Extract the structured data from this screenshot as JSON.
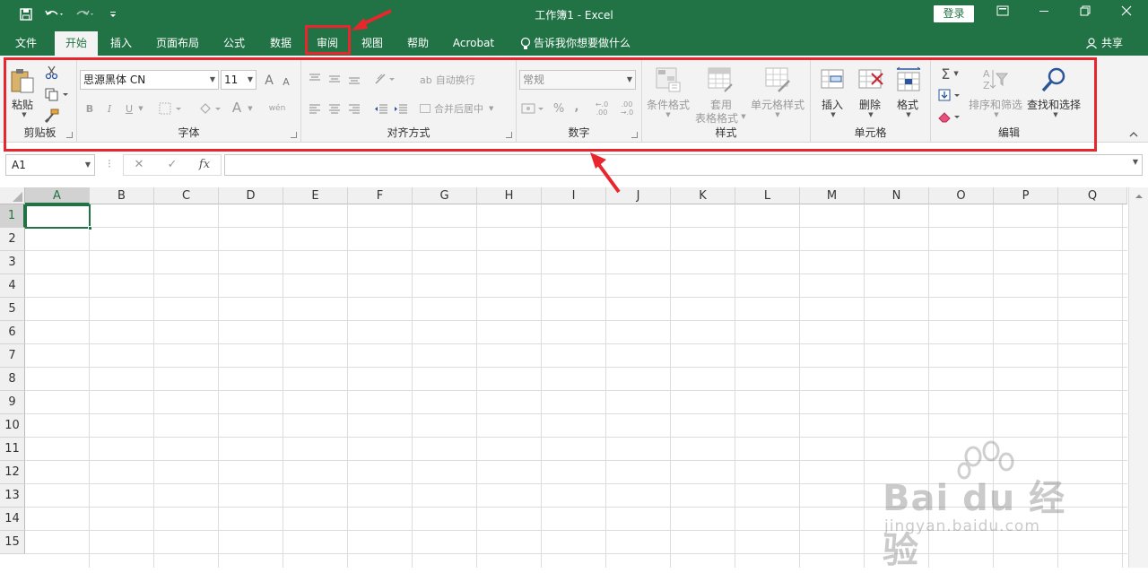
{
  "app": {
    "title": "工作簿1  -  Excel",
    "login_label": "登录",
    "share_label": "共享",
    "tell_me": "告诉我你想要做什么"
  },
  "tabs": [
    {
      "label": "文件"
    },
    {
      "label": "开始"
    },
    {
      "label": "插入"
    },
    {
      "label": "页面布局"
    },
    {
      "label": "公式"
    },
    {
      "label": "数据"
    },
    {
      "label": "审阅"
    },
    {
      "label": "视图"
    },
    {
      "label": "帮助"
    },
    {
      "label": "Acrobat"
    }
  ],
  "ribbon": {
    "clipboard": {
      "label": "剪贴板",
      "paste_label": "粘贴"
    },
    "font": {
      "label": "字体",
      "font_name": "思源黑体 CN",
      "font_size": "11",
      "bold": "B",
      "italic": "I",
      "underline": "U",
      "grow_font": "A",
      "shrink_font": "A",
      "font_color": "A",
      "phonetic": "wén"
    },
    "alignment": {
      "label": "对齐方式",
      "wrap_text": "自动换行",
      "merge_center": "合并后居中"
    },
    "number": {
      "label": "数字",
      "format": "常规",
      "percent": "%",
      "comma": ",",
      "increase_decimal": "←.0 .00",
      "decrease_decimal": ".00 →.0"
    },
    "styles": {
      "label": "样式",
      "conditional": "条件格式",
      "table_format_1": "套用",
      "table_format_2": "表格格式",
      "cell_styles": "单元格样式"
    },
    "cells": {
      "label": "单元格",
      "insert": "插入",
      "delete": "删除",
      "format": "格式"
    },
    "editing": {
      "label": "编辑",
      "sort_filter": "排序和筛选",
      "find_select": "查找和选择"
    }
  },
  "formula_bar": {
    "name_box": "A1",
    "fx": "fx",
    "value": ""
  },
  "sheet": {
    "columns": [
      "A",
      "B",
      "C",
      "D",
      "E",
      "F",
      "G",
      "H",
      "I",
      "J",
      "K",
      "L",
      "M",
      "N",
      "O",
      "P",
      "Q"
    ],
    "rows": [
      "1",
      "2",
      "3",
      "4",
      "5",
      "6",
      "7",
      "8",
      "9",
      "10",
      "11",
      "12",
      "13",
      "14",
      "15"
    ],
    "selected_cell": "A1"
  },
  "watermark": {
    "brand": "Bai du 经验",
    "url": "jingyan.baidu.com"
  },
  "colors": {
    "accent": "#217346",
    "annotation": "#e8262d"
  }
}
